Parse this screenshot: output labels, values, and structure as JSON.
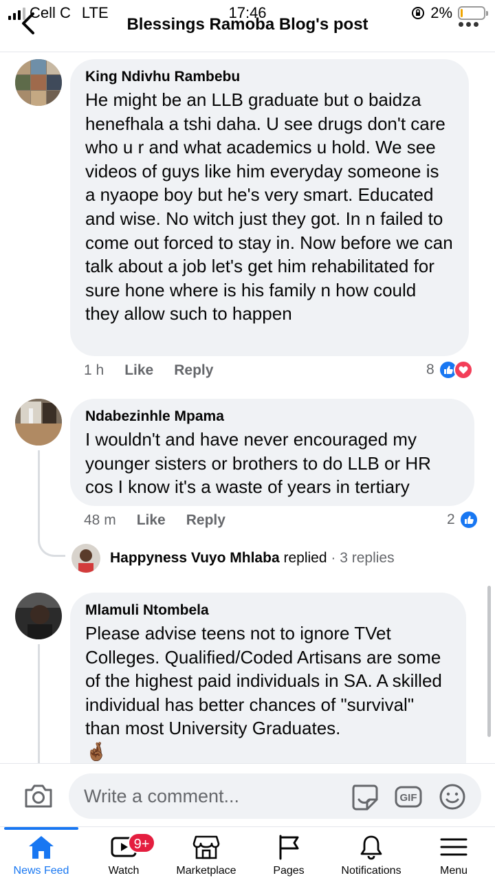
{
  "status_bar": {
    "carrier": "Cell C",
    "network": "LTE",
    "time": "17:46",
    "battery": "2%"
  },
  "header": {
    "title": "Blessings Ramoba Blog's post"
  },
  "comments": [
    {
      "author": "King Ndivhu Rambebu",
      "text": "He might be an LLB graduate but o baidza henefhala a tshi daha. U see drugs don't care who u r and what academics u hold. We see videos of guys like him everyday someone is a nyaope boy but he's very smart. Educated and wise. No witch just they got. In n failed to come out forced to stay in. Now before we can talk about a job let's get him rehabilitated for sure hone where is his family n how could they allow such to happen",
      "time": "1 h",
      "like_label": "Like",
      "reply_label": "Reply",
      "reaction_count": "8"
    },
    {
      "author": "Ndabezinhle Mpama",
      "text": "I wouldn't and have never encouraged my younger sisters or brothers to do LLB or HR cos I know it's a waste of years in tertiary",
      "time": "48 m",
      "like_label": "Like",
      "reply_label": "Reply",
      "reaction_count": "2",
      "replies_preview": {
        "name": "Happyness Vuyo Mhlaba",
        "action": "replied",
        "separator": "·",
        "count": "3 replies"
      }
    },
    {
      "author": "Mlamuli Ntombela",
      "text": "Please advise teens not to ignore TVet Colleges. Qualified/Coded Artisans are some of the highest paid individuals in SA. A skilled individual  has better chances of \"survival\" than most University Graduates.",
      "emoji": "🤞🏾"
    }
  ],
  "composer": {
    "placeholder": "Write a comment..."
  },
  "bottom_nav": {
    "items": [
      {
        "label": "News Feed",
        "icon": "home-icon",
        "active": true
      },
      {
        "label": "Watch",
        "icon": "watch-icon",
        "badge": "9+"
      },
      {
        "label": "Marketplace",
        "icon": "marketplace-icon"
      },
      {
        "label": "Pages",
        "icon": "pages-flag-icon"
      },
      {
        "label": "Notifications",
        "icon": "bell-icon"
      },
      {
        "label": "Menu",
        "icon": "hamburger-icon"
      }
    ]
  },
  "colors": {
    "accent": "#1877f2",
    "love": "#f33e58",
    "badge": "#e41e3f",
    "bubble": "#f0f2f5",
    "muted_text": "#65676b"
  }
}
